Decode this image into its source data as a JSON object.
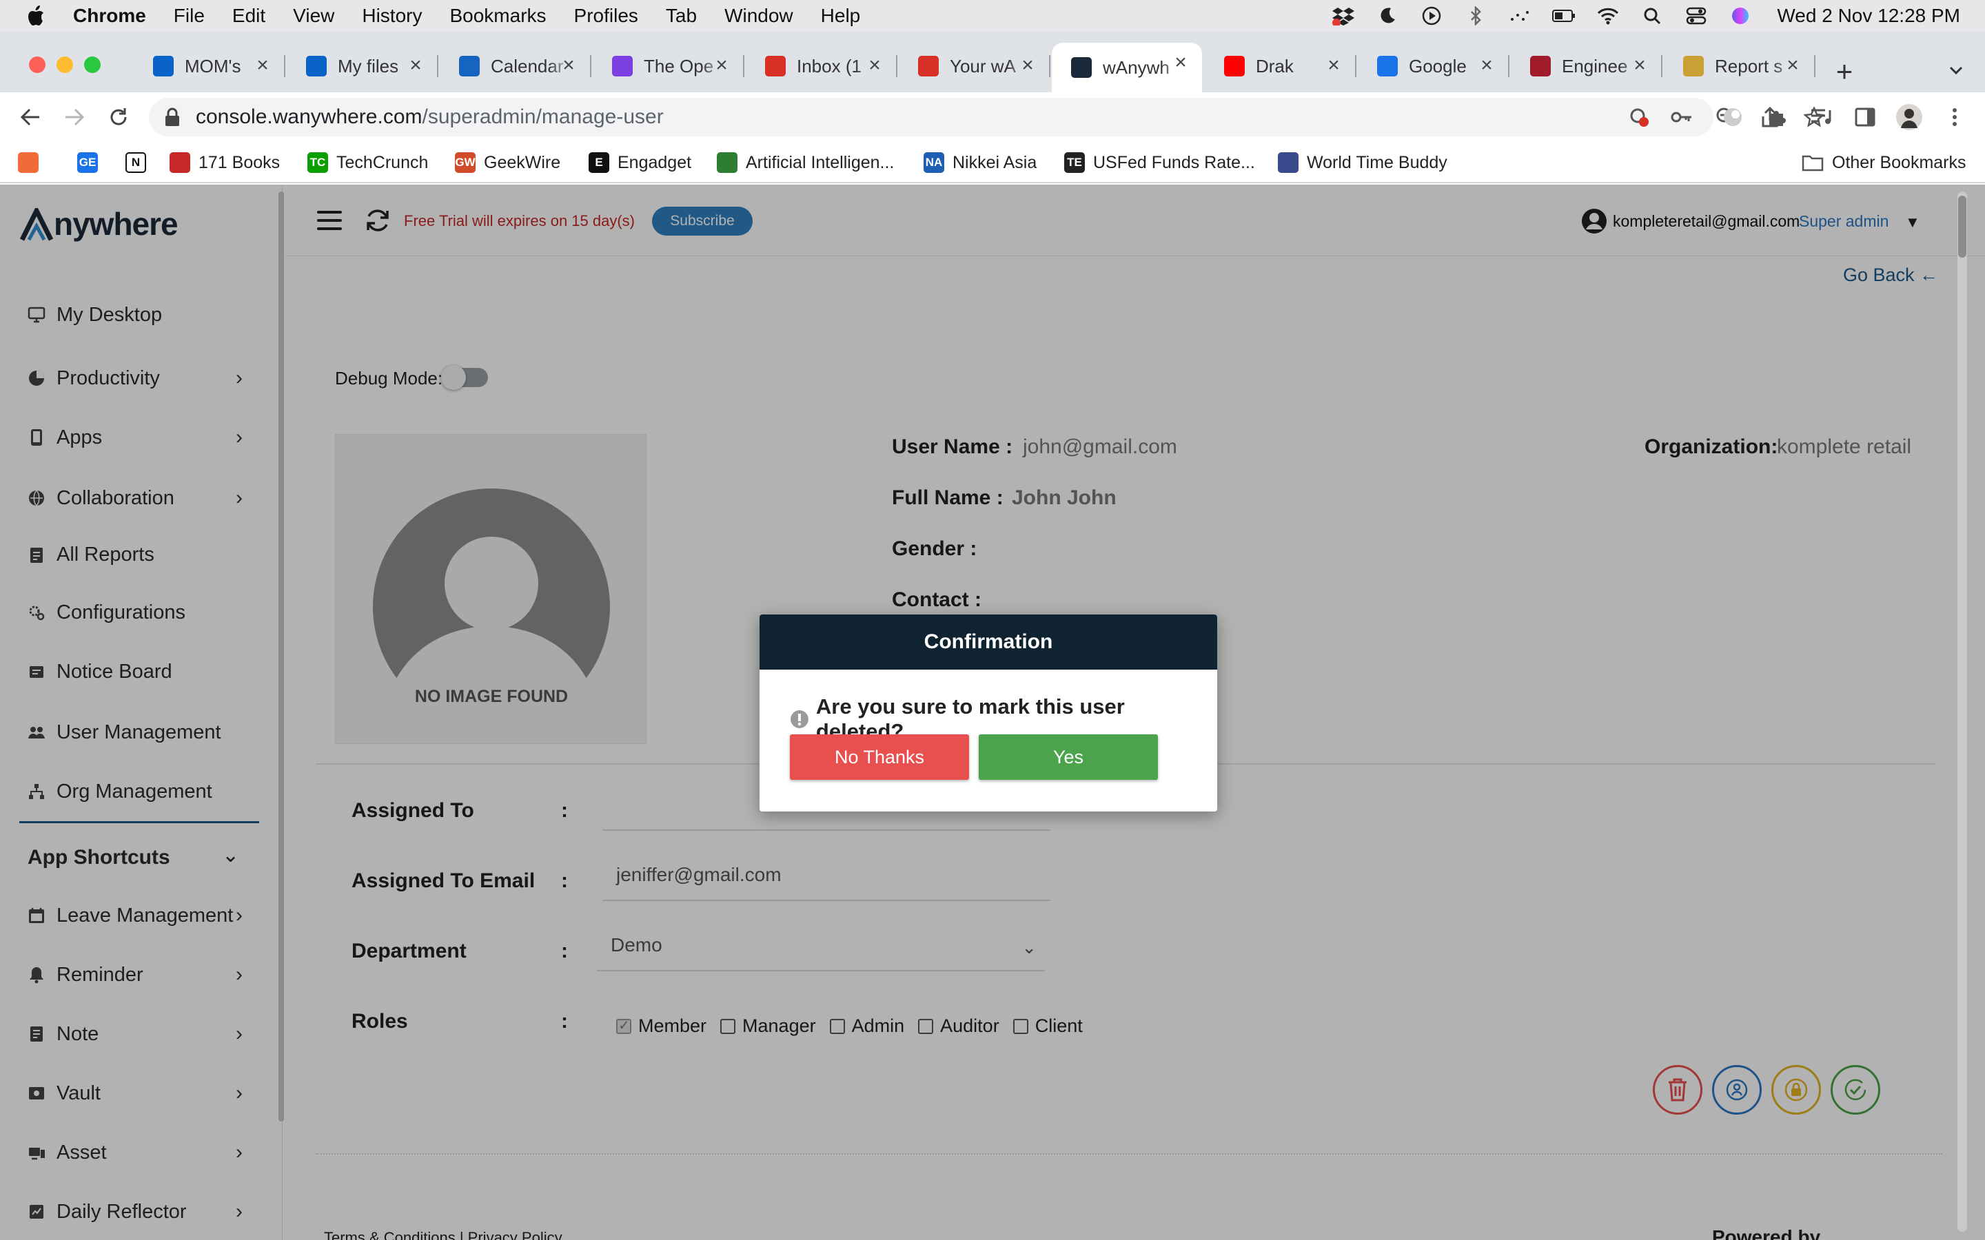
{
  "menubar": {
    "app_name": "Chrome",
    "menus": [
      "File",
      "Edit",
      "View",
      "History",
      "Bookmarks",
      "Profiles",
      "Tab",
      "Window",
      "Help"
    ],
    "clock": "Wed 2 Nov  12:28 PM"
  },
  "tabs": [
    {
      "label": "MOM's",
      "favicon": "onedrive-icon",
      "color": "#0a64c8"
    },
    {
      "label": "My files",
      "favicon": "onedrive-icon",
      "color": "#0a64c8"
    },
    {
      "label": "Calendar",
      "favicon": "calendar-icon",
      "color": "#1565c0"
    },
    {
      "label": "The Ope",
      "favicon": "openai-icon",
      "color": "#7b3fe4"
    },
    {
      "label": "Inbox (1",
      "favicon": "gmail-icon",
      "color": "#d93025"
    },
    {
      "label": "Your wA",
      "favicon": "gmail-icon",
      "color": "#d93025"
    },
    {
      "label": "wAnywh",
      "favicon": "wanywhere-icon",
      "color": "#1b2a3a",
      "active": true
    },
    {
      "label": "Drak",
      "favicon": "youtube-icon",
      "color": "#ff0000"
    },
    {
      "label": "Google",
      "favicon": "google-sheets-icon",
      "color": "#1a73e8"
    },
    {
      "label": "Enginee",
      "favicon": "news-icon",
      "color": "#a11c2b"
    },
    {
      "label": "Report s",
      "favicon": "report-icon",
      "color": "#c8a033"
    }
  ],
  "omnibox": {
    "domain": "console.wanywhere.com",
    "path": "/superadmin/manage-user"
  },
  "bookmarks": [
    {
      "label": "",
      "icon": "feather-icon",
      "color": "#ef6c3a"
    },
    {
      "label": "",
      "icon": "google-sheets-icon",
      "color": "#1a73e8",
      "text": "GE"
    },
    {
      "label": "",
      "icon": "notion-icon",
      "color": "#ffffff",
      "text": "N"
    },
    {
      "label": "171 Books",
      "icon": "apple-icon",
      "color": "#c62828"
    },
    {
      "label": "TechCrunch",
      "icon": "techcrunch-icon",
      "color": "#0a9e01",
      "text": "TC"
    },
    {
      "label": "GeekWire",
      "icon": "geekwire-icon",
      "color": "#d14b2a",
      "text": "GW"
    },
    {
      "label": "Engadget",
      "icon": "engadget-icon",
      "color": "#111111",
      "text": "E"
    },
    {
      "label": "Artificial Intelligen...",
      "icon": "dots-icon",
      "color": "#2e7d32"
    },
    {
      "label": "Nikkei Asia",
      "icon": "nikkei-icon",
      "color": "#1e5fb4",
      "text": "NA"
    },
    {
      "label": "USFed Funds Rate...",
      "icon": "te-icon",
      "color": "#222222",
      "text": "TE"
    },
    {
      "label": "World Time Buddy",
      "icon": "clock-icon",
      "color": "#3b4a8c"
    }
  ],
  "other_bookmarks": "Other Bookmarks",
  "sidebar": {
    "brand": "nywhere",
    "items": [
      {
        "label": "My Desktop",
        "icon": "desktop-icon",
        "chevron": false
      },
      {
        "label": "Productivity",
        "icon": "pie-chart-icon",
        "chevron": true
      },
      {
        "label": "Apps",
        "icon": "tablet-icon",
        "chevron": true
      },
      {
        "label": "Collaboration",
        "icon": "globe-icon",
        "chevron": true
      },
      {
        "label": "All Reports",
        "icon": "clipboard-icon",
        "chevron": false
      },
      {
        "label": "Configurations",
        "icon": "gears-icon",
        "chevron": false
      },
      {
        "label": "Notice Board",
        "icon": "notice-icon",
        "chevron": false
      },
      {
        "label": "User Management",
        "icon": "users-icon",
        "chevron": false
      },
      {
        "label": "Org Management",
        "icon": "org-icon",
        "chevron": false
      }
    ],
    "shortcuts_title": "App Shortcuts",
    "shortcuts": [
      {
        "label": "Leave Management",
        "icon": "calendar-icon",
        "chevron": true
      },
      {
        "label": "Reminder",
        "icon": "bell-icon",
        "chevron": true
      },
      {
        "label": "Note",
        "icon": "note-icon",
        "chevron": true
      },
      {
        "label": "Vault",
        "icon": "vault-icon",
        "chevron": true
      },
      {
        "label": "Asset",
        "icon": "asset-icon",
        "chevron": true
      },
      {
        "label": "Daily Reflector",
        "icon": "reflector-icon",
        "chevron": true
      }
    ]
  },
  "topbar": {
    "trial_text": "Free Trial will expires on 15 day(s)",
    "subscribe_label": "Subscribe",
    "user_email": "kompleteretail@gmail.com",
    "user_role": "Super admin"
  },
  "content": {
    "go_back": "Go Back",
    "debug_label": "Debug Mode:",
    "no_image": "NO IMAGE FOUND",
    "user_name_label": "User Name :",
    "user_name": "john@gmail.com",
    "full_name_label": "Full Name :",
    "full_name": "John John",
    "gender_label": "Gender :",
    "contact_label": "Contact :",
    "org_label": "Organization:",
    "org_value": "komplete retail",
    "assigned_to_label": "Assigned To",
    "assigned_to_value": "",
    "assigned_email_label": "Assigned To Email",
    "assigned_email_value": "jeniffer@gmail.com",
    "department_label": "Department",
    "department_value": "Demo",
    "roles_label": "Roles",
    "colon": ":",
    "roles": [
      {
        "label": "Member",
        "checked": true
      },
      {
        "label": "Manager",
        "checked": false
      },
      {
        "label": "Admin",
        "checked": false
      },
      {
        "label": "Auditor",
        "checked": false
      },
      {
        "label": "Client",
        "checked": false
      }
    ],
    "footer_left": "Terms & Conditions  |  Privacy Policy",
    "footer_right": "Powered by"
  },
  "modal": {
    "title": "Confirmation",
    "question": "Are you sure to mark this user deleted?",
    "no_label": "No Thanks",
    "yes_label": "Yes"
  },
  "colors": {
    "danger": "#e8504f",
    "success": "#4ba34b",
    "modal_header": "#0f2330",
    "accent": "#2b78c2"
  }
}
